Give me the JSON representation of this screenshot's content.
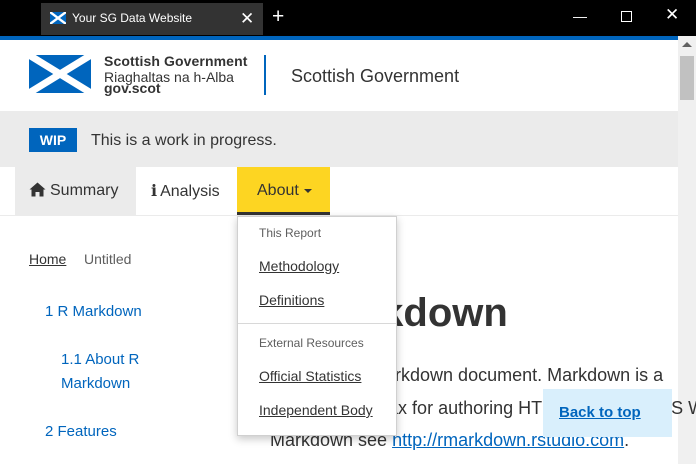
{
  "browser": {
    "tab_title": "Your SG Data Website",
    "close_glyph": "✕",
    "new_tab_glyph": "+",
    "minimize_glyph": "—",
    "window_close_glyph": "✕"
  },
  "header": {
    "logo_line1": "Scottish Government",
    "logo_line2": "Riaghaltas na h-Alba",
    "logo_line3": "gov.scot",
    "site_title": "Scottish Government"
  },
  "banner": {
    "badge": "WIP",
    "text": "This is a work in progress."
  },
  "nav": {
    "items": [
      {
        "label": "Summary",
        "icon": "home-icon"
      },
      {
        "label": "Analysis",
        "icon": "info-icon"
      },
      {
        "label": "About",
        "icon": "caret-down-icon",
        "active": true
      }
    ]
  },
  "dropdown": {
    "header1": "This Report",
    "items1": [
      "Methodology",
      "Definitions"
    ],
    "header2": "External Resources",
    "items2": [
      "Official Statistics",
      "Independent Body"
    ]
  },
  "breadcrumb": {
    "home": "Home",
    "current": "Untitled"
  },
  "toc": {
    "items": [
      "1 R Markdown",
      "1.1 About R Markdown",
      "2 Features"
    ]
  },
  "content": {
    "heading": "R Markdown",
    "line1": "This is an R Markdown document. Markdown is a",
    "line2": "formatting syntax for authoring HTML, PDF, and MS Wo",
    "line3_prefix": "Markdown see ",
    "line3_link": "http://rmarkdown.rstudio.com",
    "line3_suffix": "."
  },
  "back_to_top": "Back to top",
  "colors": {
    "brand_blue": "#0065bd",
    "active_yellow": "#fdd522",
    "banner_grey": "#ebebeb"
  }
}
